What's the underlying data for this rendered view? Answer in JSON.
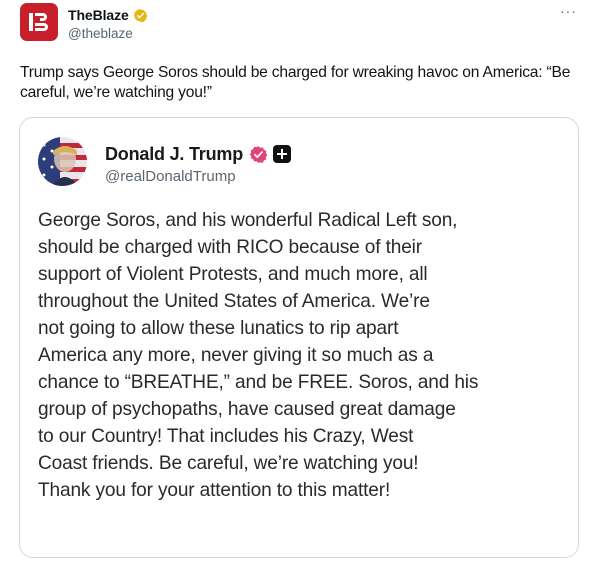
{
  "tweet": {
    "display_name": "TheBlaze",
    "handle": "@theblaze",
    "more_label": "···",
    "text": "Trump says George Soros should be charged for wreaking havoc on America: “Be careful, we’re watching you!”",
    "avatar_icon": "theblaze-logo",
    "verified_icon": "gold-verified-badge",
    "colors": {
      "brand": "#c8202b",
      "verified_gold": "#e2b719",
      "secondary_text": "#536471"
    }
  },
  "quote": {
    "display_name": "Donald J. Trump",
    "handle": "@realDonaldTrump",
    "avatar_icon": "flag-portrait-avatar",
    "verified_icon": "pink-verified-badge",
    "extra_icon": "plus-badge-icon",
    "colors": {
      "verified_pink": "#e0447a",
      "border": "#cfd9de"
    },
    "body_lines": [
      "George Soros, and his wonderful Radical Left son,",
      "should be charged with RICO because of their",
      "support of Violent Protests, and much more, all",
      "throughout the United States of America. We’re",
      "not going to allow these lunatics to rip apart",
      "America any more, never giving it so much as a",
      "chance to “BREATHE,” and be FREE. Soros, and his",
      "group of psychopaths, have caused great damage",
      "to our Country! That includes his Crazy, West",
      "Coast friends. Be careful, we’re watching you!",
      "Thank you for your attention to this matter!"
    ]
  }
}
